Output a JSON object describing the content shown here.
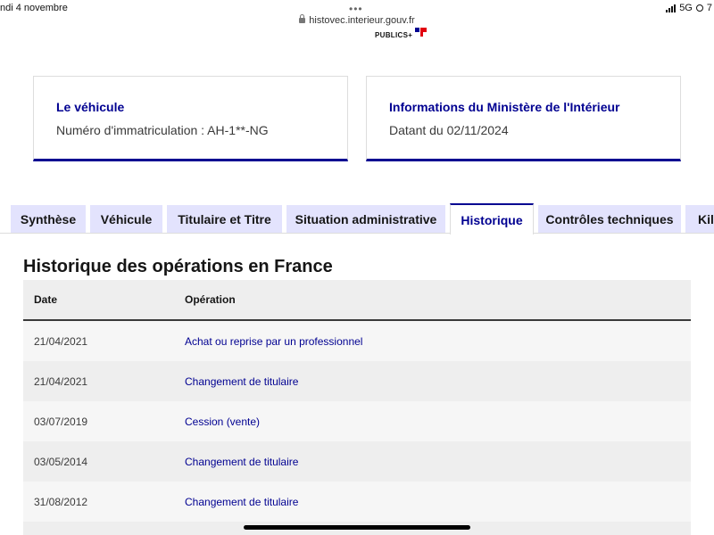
{
  "statusbar": {
    "date": "ndi 4 novembre",
    "url": "histovec.interieur.gouv.fr",
    "network": "5G",
    "right_suffix": "7"
  },
  "logo": {
    "text": "PUBLICS+"
  },
  "cards": [
    {
      "title": "Le véhicule",
      "text": "Numéro d'immatriculation : AH-1**-NG"
    },
    {
      "title": "Informations du Ministère de l'Intérieur",
      "text": "Datant du 02/11/2024"
    }
  ],
  "tabs": [
    {
      "label": "Synthèse",
      "active": false
    },
    {
      "label": "Véhicule",
      "active": false
    },
    {
      "label": "Titulaire et Titre",
      "active": false
    },
    {
      "label": "Situation administrative",
      "active": false
    },
    {
      "label": "Historique",
      "active": true
    },
    {
      "label": "Contrôles techniques",
      "active": false
    },
    {
      "label": "Kilo",
      "active": false
    }
  ],
  "section": {
    "title": "Historique des opérations en France",
    "columns": {
      "date": "Date",
      "operation": "Opération"
    },
    "rows": [
      {
        "date": "21/04/2021",
        "operation": "Achat ou reprise par un professionnel"
      },
      {
        "date": "21/04/2021",
        "operation": "Changement de titulaire"
      },
      {
        "date": "03/07/2019",
        "operation": "Cession (vente)"
      },
      {
        "date": "03/05/2014",
        "operation": "Changement de titulaire"
      },
      {
        "date": "31/08/2012",
        "operation": "Changement de titulaire"
      }
    ]
  },
  "colors": {
    "accent": "#000091",
    "tab_bg": "#e3e3fd",
    "header_bg": "#eeeeee"
  }
}
